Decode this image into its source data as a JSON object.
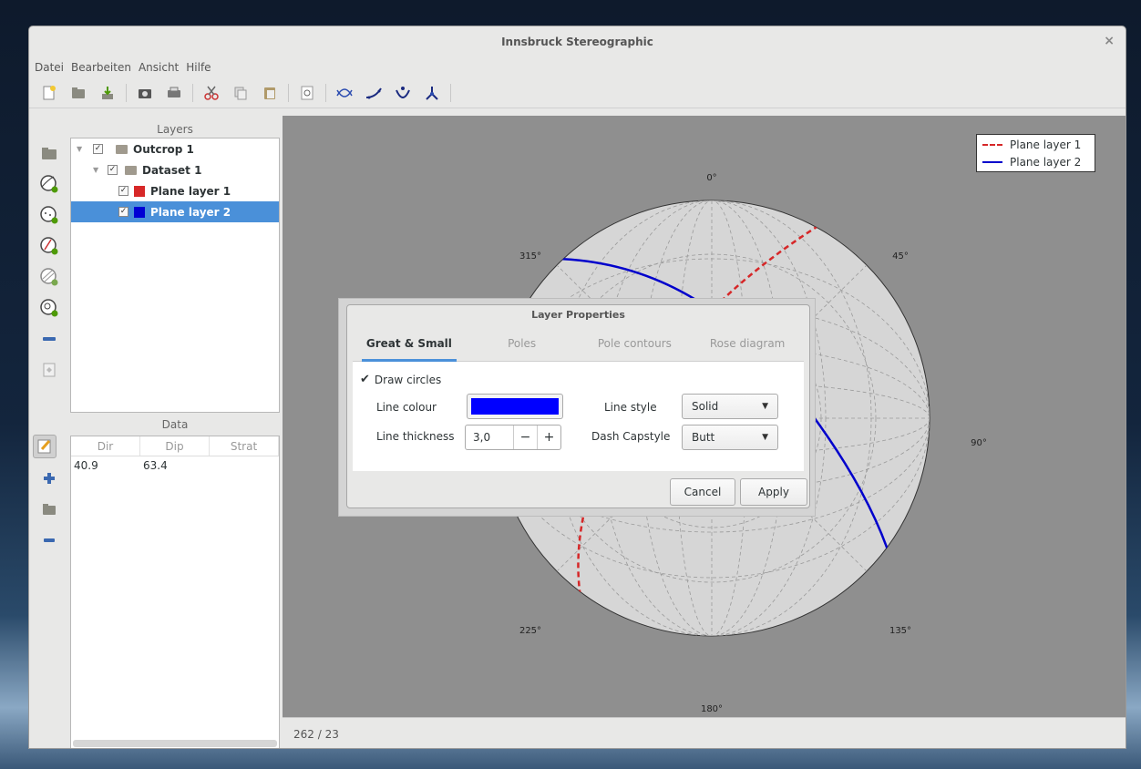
{
  "app": {
    "title": "Innsbruck Stereographic",
    "close_glyph": "×"
  },
  "menu": [
    "Datei",
    "Bearbeiten",
    "Ansicht",
    "Hilfe"
  ],
  "toolbar_icons": [
    "new-file-icon",
    "open-folder-icon",
    "import-icon",
    "screenshot-icon",
    "print-icon",
    "cut-icon",
    "copy-icon",
    "paste-icon",
    "zoom-icon",
    "great-circle-icon",
    "line-icon",
    "small-circle-icon",
    "mean-vector-icon"
  ],
  "layers_panel": {
    "title": "Layers",
    "items": [
      {
        "label": "Outcrop 1",
        "type": "folder",
        "checked": true
      },
      {
        "label": "Dataset 1",
        "type": "folder",
        "checked": true
      },
      {
        "label": "Plane layer 1",
        "type": "plane",
        "color": "#d72828",
        "checked": true
      },
      {
        "label": "Plane layer 2",
        "type": "plane",
        "color": "#0000d4",
        "checked": true
      }
    ]
  },
  "data_panel": {
    "title": "Data",
    "columns": [
      "Dir",
      "Dip",
      "Strat"
    ],
    "rows": [
      [
        "40.9",
        "63.4",
        ""
      ]
    ]
  },
  "plot": {
    "direction_labels": {
      "n": "0°",
      "ne": "45°",
      "e": "90°",
      "se": "135°",
      "s": "180°",
      "sw": "225°",
      "nw": "315°"
    },
    "legend": [
      {
        "label": "Plane layer 1",
        "color": "#d62728",
        "style": "dashed"
      },
      {
        "label": "Plane layer 2",
        "color": "#0000cc",
        "style": "solid"
      }
    ]
  },
  "status": {
    "coords": "262 / 23"
  },
  "dialog": {
    "title": "Layer Properties",
    "tabs": [
      "Great & Small circles",
      "Poles",
      "Pole contours",
      "Rose diagram"
    ],
    "draw_circles_label": "Draw circles",
    "line_colour_label": "Line colour",
    "line_colour_value": "#0000ff",
    "line_thickness_label": "Line thickness",
    "line_thickness_value": "3,0",
    "minus": "−",
    "plus": "+",
    "line_style_label": "Line style",
    "line_style_value": "Solid",
    "dash_capstyle_label": "Dash Capstyle",
    "dash_capstyle_value": "Butt",
    "cancel": "Cancel",
    "apply": "Apply"
  }
}
